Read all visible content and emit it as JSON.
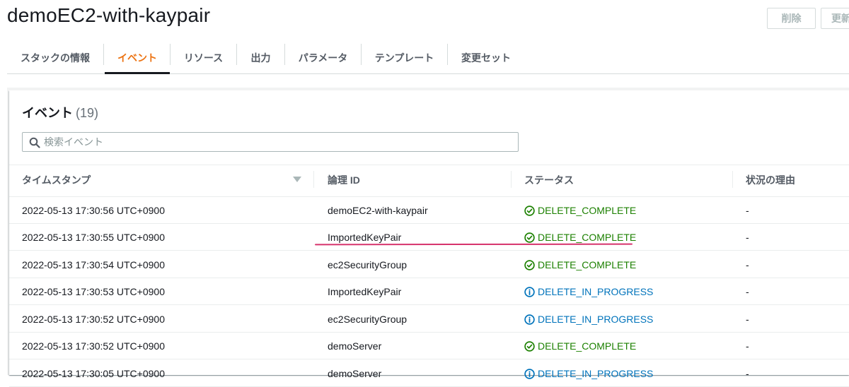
{
  "header": {
    "title": "demoEC2-with-kaypair",
    "buttons": {
      "delete": "削除",
      "update": "更新"
    }
  },
  "tabs": [
    {
      "label": "スタックの情報",
      "active": false
    },
    {
      "label": "イベント",
      "active": true
    },
    {
      "label": "リソース",
      "active": false
    },
    {
      "label": "出力",
      "active": false
    },
    {
      "label": "パラメータ",
      "active": false
    },
    {
      "label": "テンプレート",
      "active": false
    },
    {
      "label": "変更セット",
      "active": false
    }
  ],
  "panel": {
    "title": "イベント",
    "count": "(19)"
  },
  "search": {
    "placeholder": "検索イベント",
    "value": ""
  },
  "table": {
    "columns": {
      "timestamp": "タイムスタンプ",
      "logical_id": "論理 ID",
      "status": "ステータス",
      "reason": "状況の理由"
    },
    "rows": [
      {
        "timestamp": "2022-05-13 17:30:56 UTC+0900",
        "logical_id": "demoEC2-with-kaypair",
        "status": "DELETE_COMPLETE",
        "status_kind": "success",
        "reason": "-"
      },
      {
        "timestamp": "2022-05-13 17:30:55 UTC+0900",
        "logical_id": "ImportedKeyPair",
        "status": "DELETE_COMPLETE",
        "status_kind": "success",
        "reason": "-"
      },
      {
        "timestamp": "2022-05-13 17:30:54 UTC+0900",
        "logical_id": "ec2SecurityGroup",
        "status": "DELETE_COMPLETE",
        "status_kind": "success",
        "reason": "-"
      },
      {
        "timestamp": "2022-05-13 17:30:53 UTC+0900",
        "logical_id": "ImportedKeyPair",
        "status": "DELETE_IN_PROGRESS",
        "status_kind": "info",
        "reason": "-"
      },
      {
        "timestamp": "2022-05-13 17:30:52 UTC+0900",
        "logical_id": "ec2SecurityGroup",
        "status": "DELETE_IN_PROGRESS",
        "status_kind": "info",
        "reason": "-"
      },
      {
        "timestamp": "2022-05-13 17:30:52 UTC+0900",
        "logical_id": "demoServer",
        "status": "DELETE_COMPLETE",
        "status_kind": "success",
        "reason": "-"
      },
      {
        "timestamp": "2022-05-13 17:30:05 UTC+0900",
        "logical_id": "demoServer",
        "status": "DELETE_IN_PROGRESS",
        "status_kind": "info",
        "reason": "-"
      }
    ]
  },
  "colors": {
    "accent_tab": "#ec7211",
    "success": "#1d8102",
    "info": "#0073bb",
    "annotation": "#d6336c"
  },
  "icons": {
    "success": "check-circle-icon",
    "info": "info-circle-icon",
    "search": "search-icon",
    "sort": "caret-down-icon"
  }
}
